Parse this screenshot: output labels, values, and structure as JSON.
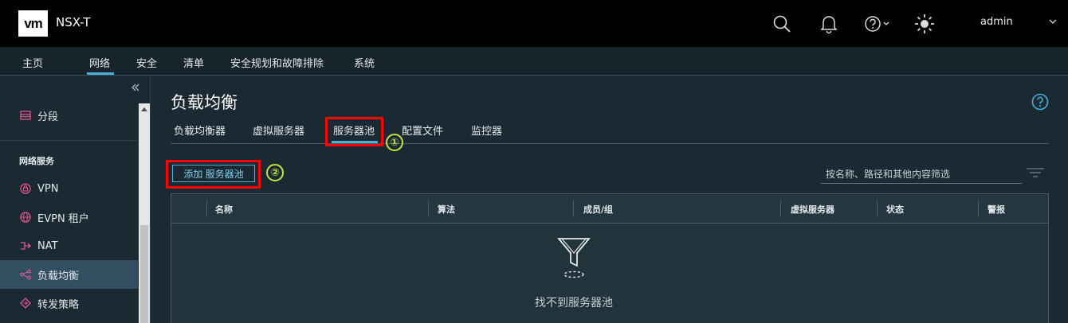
{
  "header": {
    "logo": "vm",
    "product": "NSX-T",
    "user": "admin"
  },
  "nav": {
    "items": [
      "主页",
      "网络",
      "安全",
      "清单",
      "安全规划和故障排除",
      "系统"
    ],
    "active": "网络"
  },
  "sidebar": {
    "items": [
      {
        "label": "分段",
        "icon": "segment-icon"
      },
      {
        "label": "VPN",
        "icon": "vpn-icon"
      },
      {
        "label": "EVPN 租户",
        "icon": "globe-icon"
      },
      {
        "label": "NAT",
        "icon": "nat-icon"
      },
      {
        "label": "负载均衡",
        "icon": "load-balancer-icon",
        "active": true
      },
      {
        "label": "转发策略",
        "icon": "forwarding-policy-icon"
      }
    ],
    "section_title": "网络服务"
  },
  "main": {
    "title": "负载均衡",
    "tabs": [
      "负载均衡器",
      "虚拟服务器",
      "服务器池",
      "配置文件",
      "监控器"
    ],
    "active_tab": "服务器池",
    "add_button": "添加 服务器池",
    "filter_placeholder": "按名称、路径和其他内容筛选",
    "annotations": [
      "①",
      "②"
    ],
    "columns": [
      "名称",
      "算法",
      "成员/组",
      "虚拟服务器",
      "状态",
      "警报"
    ],
    "empty_text": "找不到服务器池"
  },
  "colors": {
    "accent": "#49afd9",
    "annotation_box": "#ff0000",
    "annotation_circle": "#c6e33b"
  }
}
